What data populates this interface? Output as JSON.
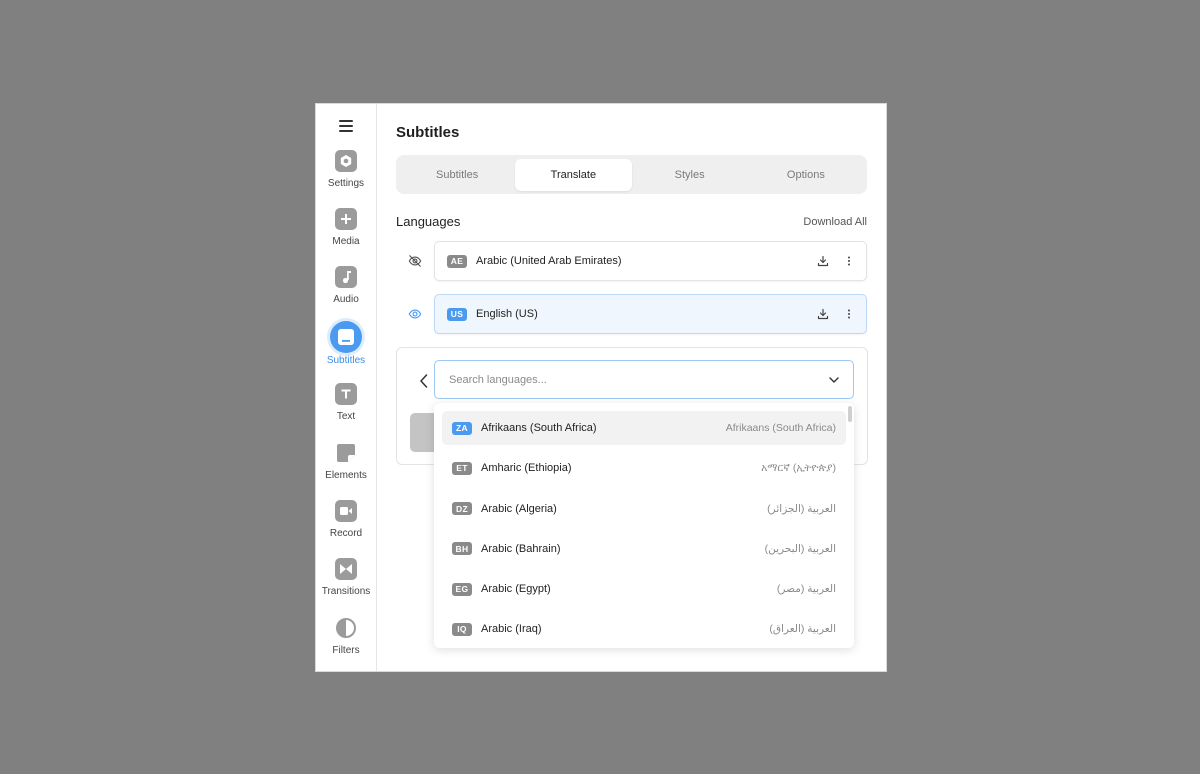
{
  "sidebar": {
    "items": [
      {
        "label": "Settings",
        "icon": "settings-icon"
      },
      {
        "label": "Media",
        "icon": "plus-icon"
      },
      {
        "label": "Audio",
        "icon": "music-note-icon"
      },
      {
        "label": "Subtitles",
        "icon": "subtitles-icon"
      },
      {
        "label": "Text",
        "icon": "text-icon"
      },
      {
        "label": "Elements",
        "icon": "elements-icon"
      },
      {
        "label": "Record",
        "icon": "record-icon"
      },
      {
        "label": "Transitions",
        "icon": "transitions-icon"
      },
      {
        "label": "Filters",
        "icon": "filters-icon"
      }
    ],
    "active_index": 3
  },
  "main": {
    "title": "Subtitles",
    "tabs": [
      {
        "label": "Subtitles"
      },
      {
        "label": "Translate"
      },
      {
        "label": "Styles"
      },
      {
        "label": "Options"
      }
    ],
    "active_tab": "Translate"
  },
  "languages": {
    "title": "Languages",
    "download_all": "Download All",
    "items": [
      {
        "code": "AE",
        "name": "Arabic (United Arab Emirates)",
        "visible": false
      },
      {
        "code": "US",
        "name": "English (US)",
        "visible": true
      }
    ]
  },
  "search": {
    "placeholder": "Search languages..."
  },
  "dropdown": {
    "options": [
      {
        "code": "ZA",
        "name": "Afrikaans (South Africa)",
        "native": "Afrikaans (South Africa)"
      },
      {
        "code": "ET",
        "name": "Amharic (Ethiopia)",
        "native": "አማርኛ (ኢትዮጵያ)"
      },
      {
        "code": "DZ",
        "name": "Arabic (Algeria)",
        "native": "العربية (الجزائر)"
      },
      {
        "code": "BH",
        "name": "Arabic (Bahrain)",
        "native": "العربية (البحرين)"
      },
      {
        "code": "EG",
        "name": "Arabic (Egypt)",
        "native": "العربية (مصر)"
      },
      {
        "code": "IQ",
        "name": "Arabic (Iraq)",
        "native": "العربية (العراق)"
      }
    ]
  },
  "colors": {
    "accent": "#4a9af0",
    "background": "#808080"
  }
}
